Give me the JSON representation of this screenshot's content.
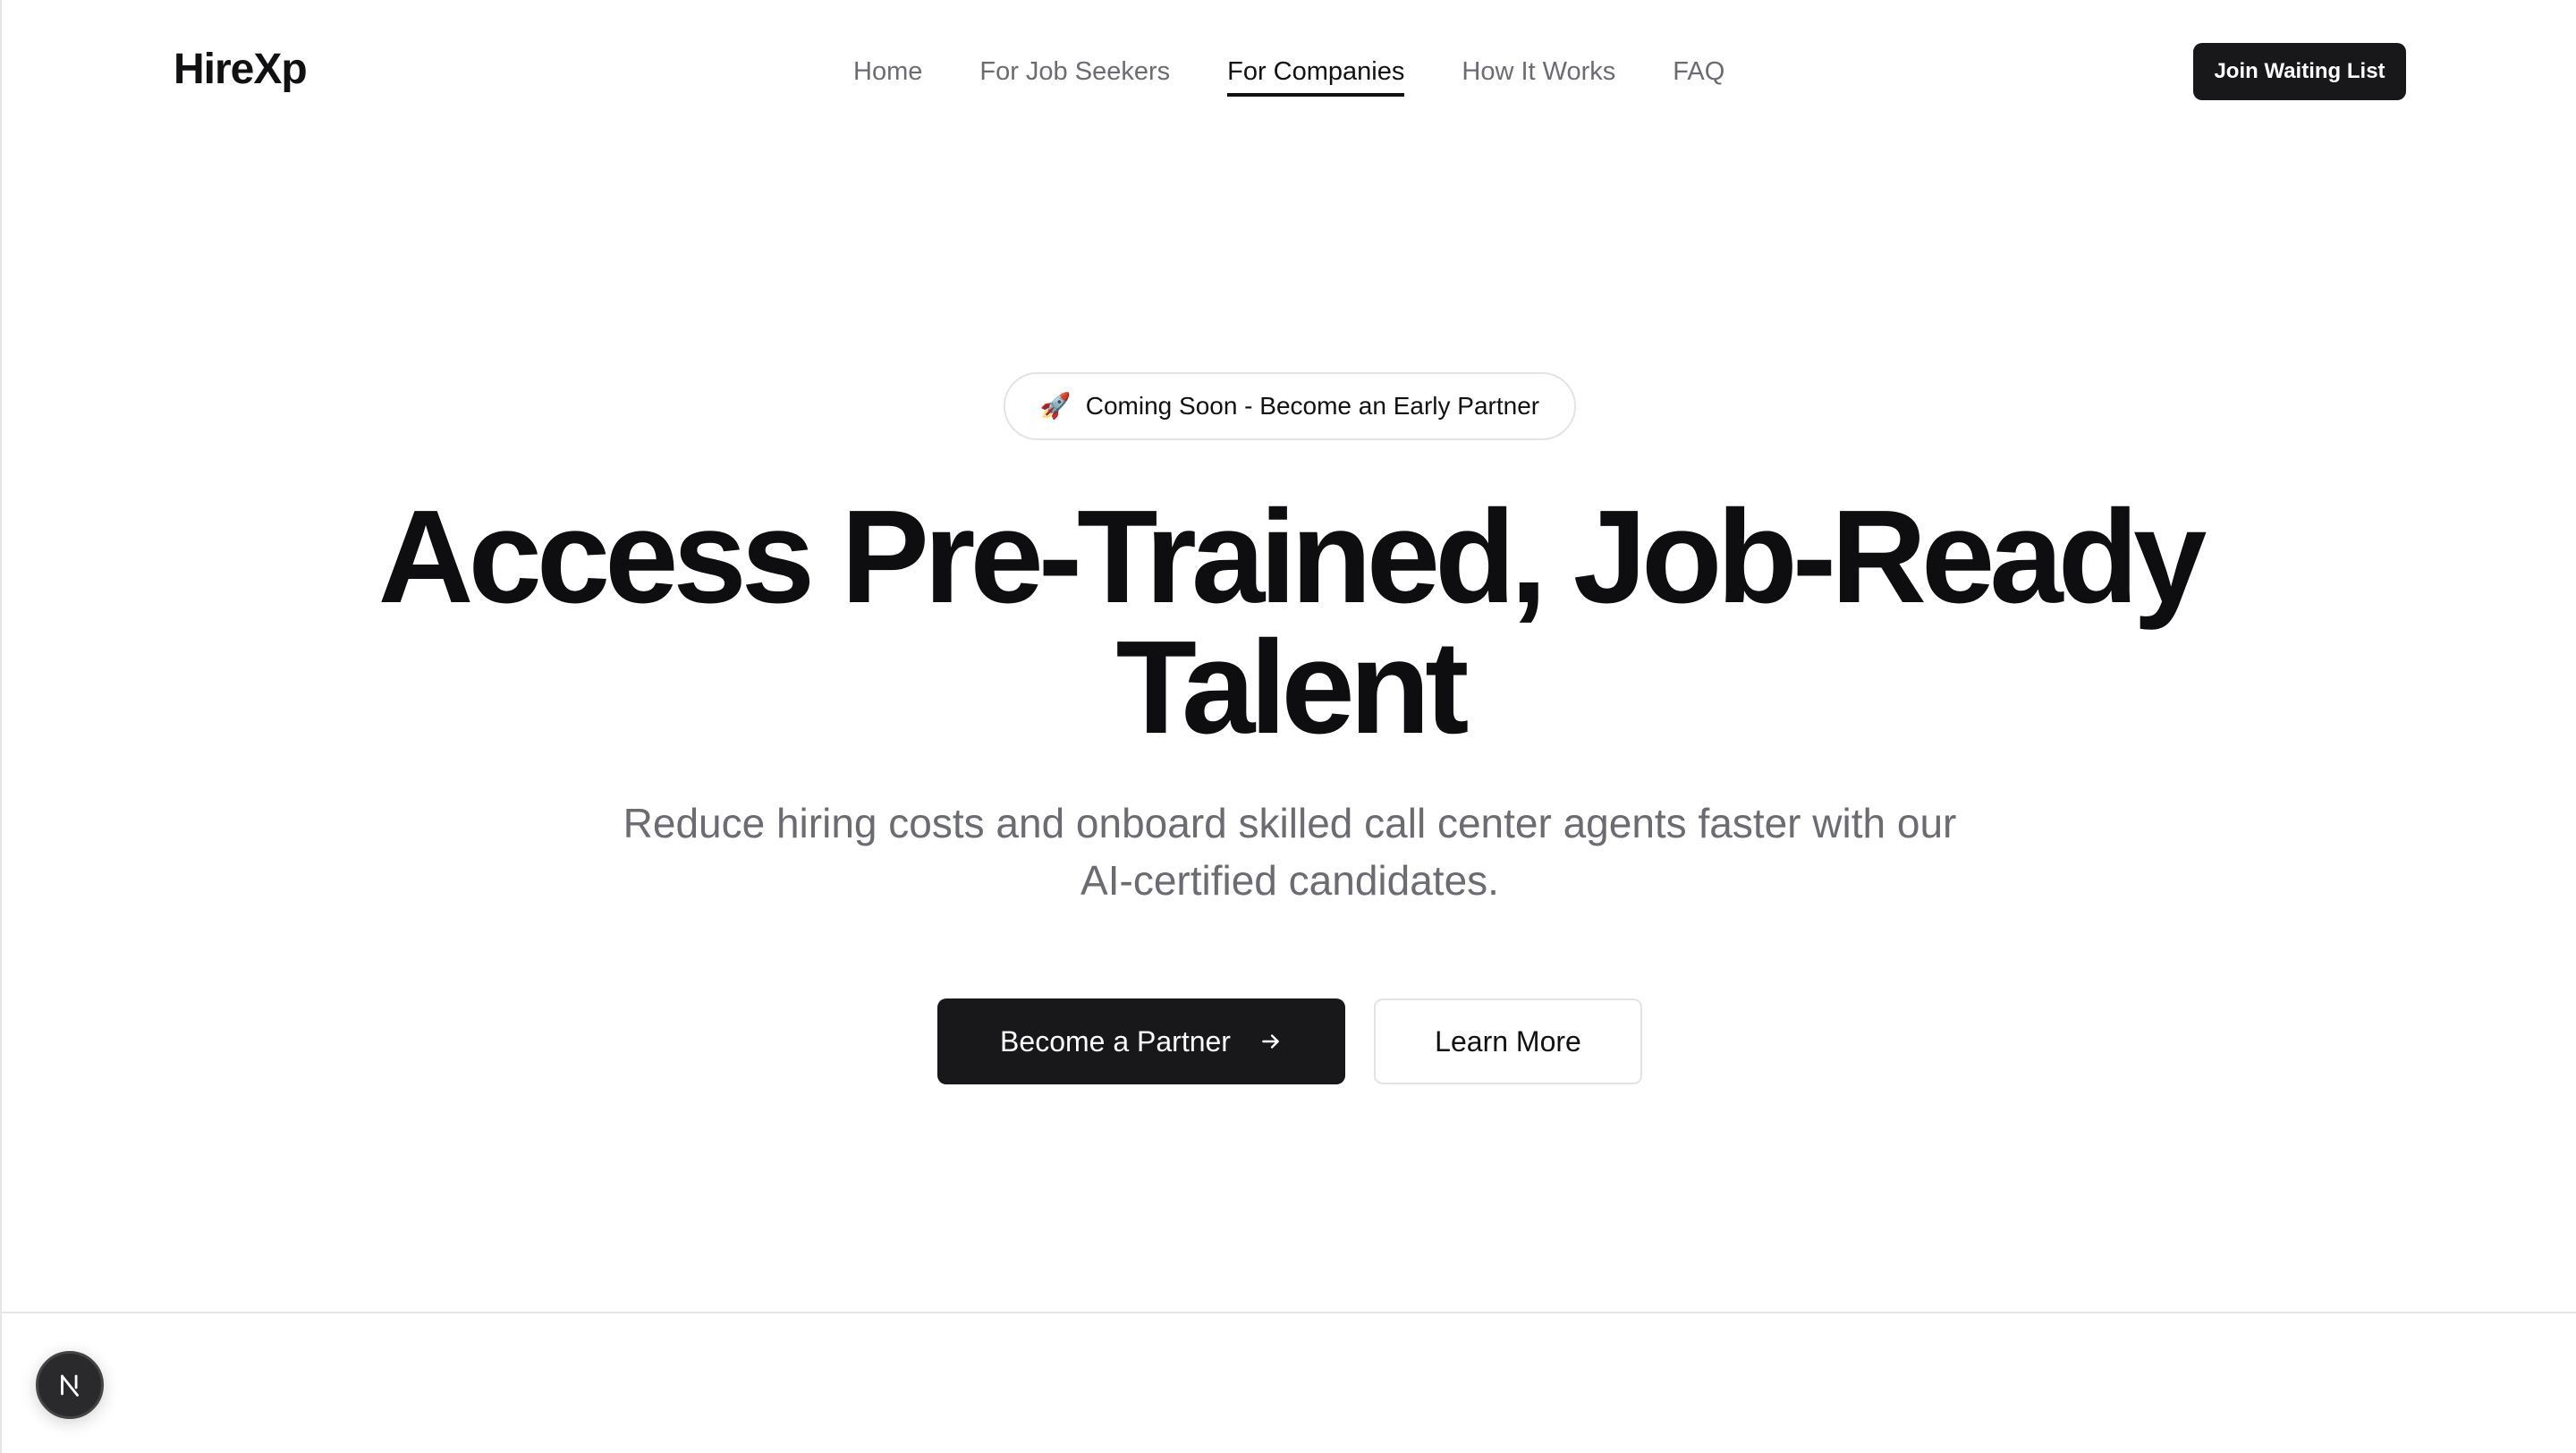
{
  "header": {
    "brand": "HireXp",
    "nav": [
      {
        "label": "Home",
        "active": false
      },
      {
        "label": "For Job Seekers",
        "active": false
      },
      {
        "label": "For Companies",
        "active": true
      },
      {
        "label": "How It Works",
        "active": false
      },
      {
        "label": "FAQ",
        "active": false
      }
    ],
    "cta_label": "Join Waiting List"
  },
  "hero": {
    "badge_icon": "rocket-icon",
    "badge_text": "Coming Soon - Become an Early Partner",
    "title_line1": "Access Pre-Trained, Job-Ready",
    "title_line2": "Talent",
    "subtitle_line1": "Reduce hiring costs and onboard skilled call center agents faster with our",
    "subtitle_line2": "AI-certified candidates.",
    "primary_button": "Become a Partner",
    "secondary_button": "Learn More"
  },
  "colors": {
    "primary": "#18181b",
    "muted_text": "#6b6b72",
    "border": "#e3e3e6"
  }
}
